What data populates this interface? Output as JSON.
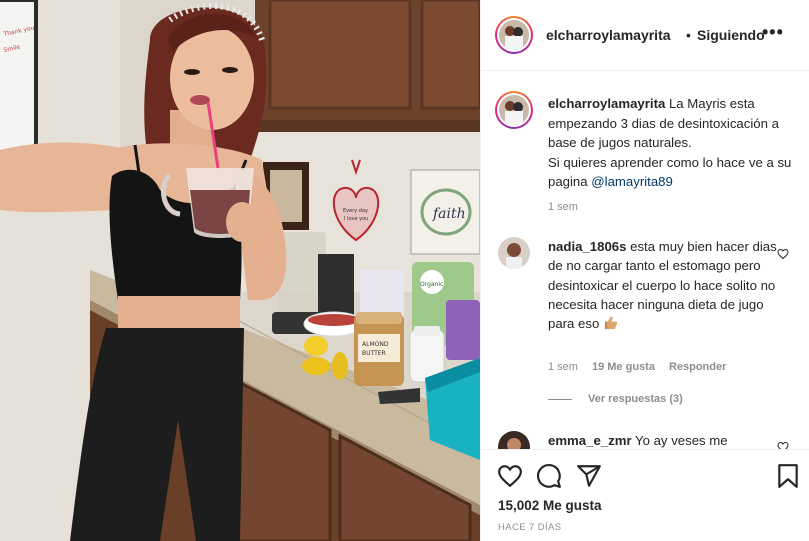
{
  "post": {
    "username": "elcharroylamayrita",
    "separator": "•",
    "follow_status": "Siguiendo",
    "more_label": "•••"
  },
  "caption": {
    "username": "elcharroylamayrita",
    "text": "La Mayris esta empezando 3 dias de desintoxicación a base de jugos naturales.",
    "text2": "Si quieres aprender como lo hace ve a su pagina",
    "mention": "@lamayrita89",
    "time": "1 sem"
  },
  "comments": [
    {
      "username": "nadia_1806s",
      "text": "esta muy bien hacer dias de no cargar tanto el estomago pero desintoxicar el cuerpo lo hace solito no necesita hacer ninguna dieta de jugo para eso",
      "time": "1 sem",
      "likes": "19 Me gusta",
      "reply_label": "Responder",
      "view_replies": "Ver respuestas (3)"
    },
    {
      "username": "emma_e_zmr",
      "text": "Yo ay veses me"
    }
  ],
  "footer": {
    "likes": "15,002 Me gusta",
    "time_ago": "HACE 7 DÍAS"
  },
  "photo": {
    "sign_text": "faith",
    "heart_text": "Every day I love you more",
    "whiteboard_text": "Thank you\nSmile\nwashington",
    "jar_label": "ALMOND BUTTER",
    "bag_label": "Organic\nGround\nFlaxseed"
  },
  "icons": [
    "heart-icon",
    "comment-icon",
    "share-icon",
    "bookmark-icon",
    "more-icon",
    "comment-heart-icon",
    "thumbs-up-emoji"
  ]
}
